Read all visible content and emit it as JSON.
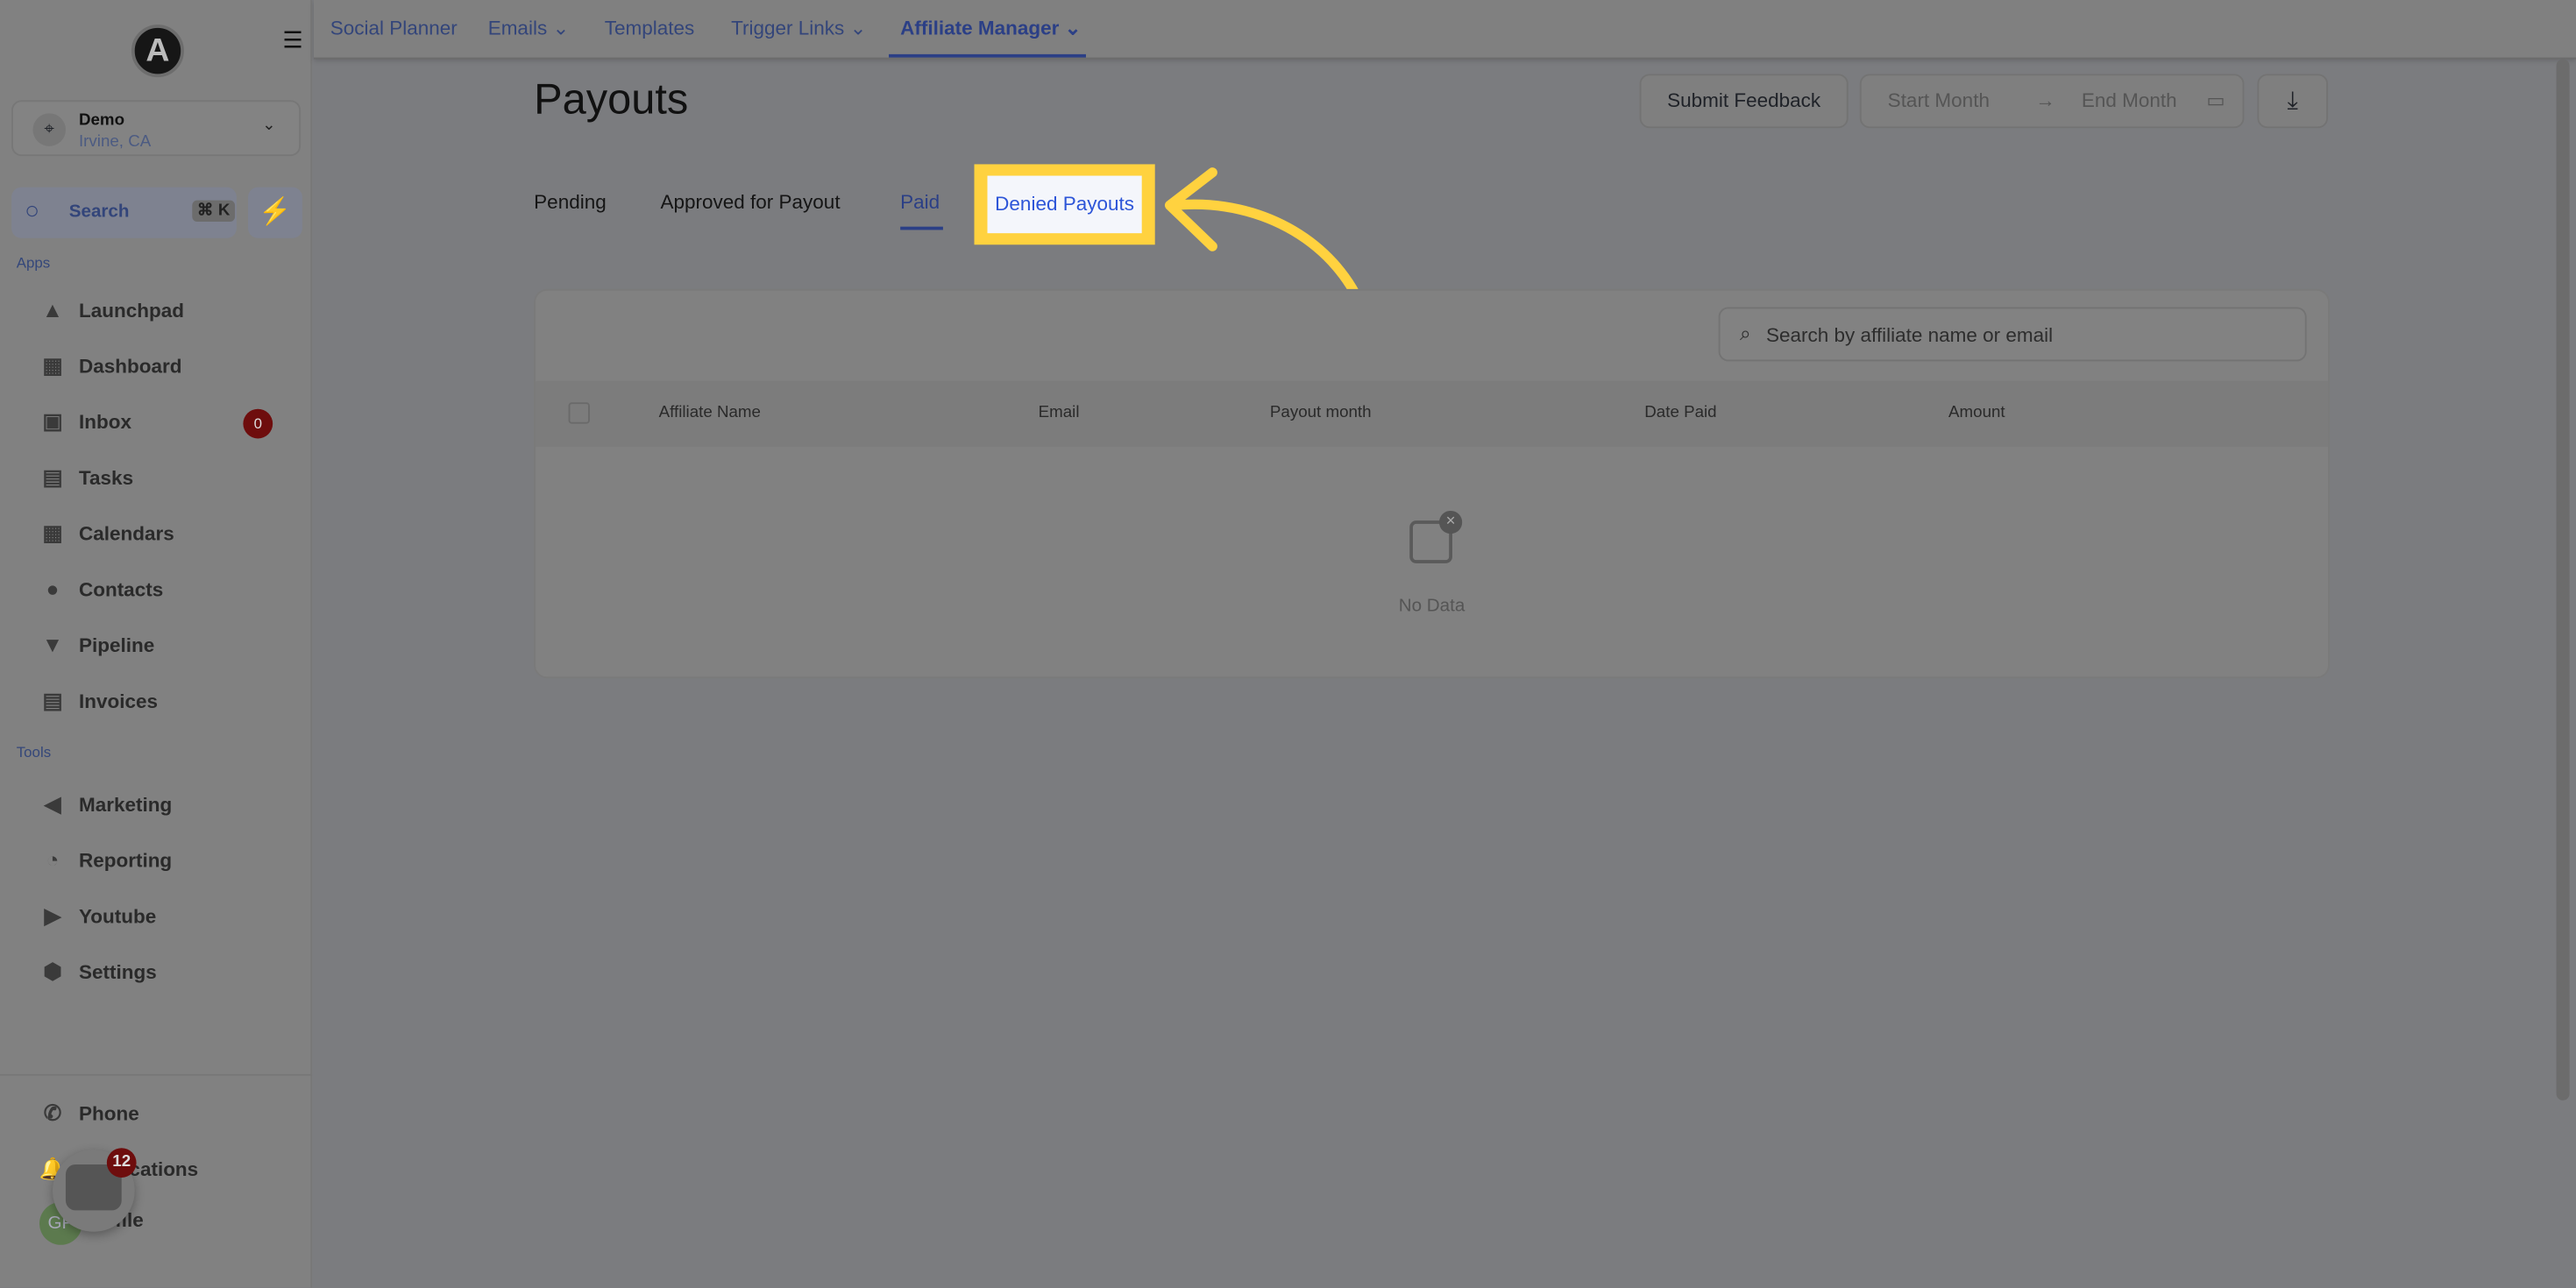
{
  "sidebar": {
    "logo": "A",
    "account": {
      "name": "Demo",
      "location": "Irvine, CA"
    },
    "search": {
      "label": "Search",
      "shortcut": "⌘ K"
    },
    "sections": {
      "apps": "Apps",
      "tools": "Tools"
    },
    "apps": [
      {
        "label": "Launchpad",
        "icon": "rocket-icon"
      },
      {
        "label": "Dashboard",
        "icon": "grid-icon"
      },
      {
        "label": "Inbox",
        "icon": "inbox-icon",
        "badge": "0"
      },
      {
        "label": "Tasks",
        "icon": "clipboard-icon"
      },
      {
        "label": "Calendars",
        "icon": "calendar-icon"
      },
      {
        "label": "Contacts",
        "icon": "person-icon"
      },
      {
        "label": "Pipeline",
        "icon": "funnel-icon"
      },
      {
        "label": "Invoices",
        "icon": "receipt-icon"
      }
    ],
    "tools": [
      {
        "label": "Marketing",
        "icon": "megaphone-icon"
      },
      {
        "label": "Reporting",
        "icon": "pie-icon"
      },
      {
        "label": "Youtube",
        "icon": "youtube-icon"
      },
      {
        "label": "Settings",
        "icon": "gear-icon"
      }
    ],
    "bottom": {
      "phone": "Phone",
      "notifications": "Notifications",
      "profile": "Profile",
      "avatar": "GP",
      "chat_count": "12"
    }
  },
  "topnav": [
    {
      "label": "Social Planner"
    },
    {
      "label": "Emails",
      "dropdown": true
    },
    {
      "label": "Templates"
    },
    {
      "label": "Trigger Links",
      "dropdown": true
    },
    {
      "label": "Affiliate Manager",
      "dropdown": true,
      "active": true
    }
  ],
  "page": {
    "title": "Payouts",
    "submit_feedback": "Submit Feedback",
    "start_month": "Start Month",
    "end_month": "End Month",
    "tabs": [
      "Pending",
      "Approved for Payout",
      "Paid",
      "Denied Payouts"
    ],
    "active_tab": "Paid",
    "highlighted_tab": "Denied Payouts",
    "search_placeholder": "Search by affiliate name or email",
    "columns": [
      "Affiliate Name",
      "Email",
      "Payout month",
      "Date Paid",
      "Amount"
    ],
    "empty": "No Data"
  },
  "colors": {
    "accent": "#2b3f86",
    "highlight": "#ffd23f",
    "badge": "#6e0d0d"
  }
}
